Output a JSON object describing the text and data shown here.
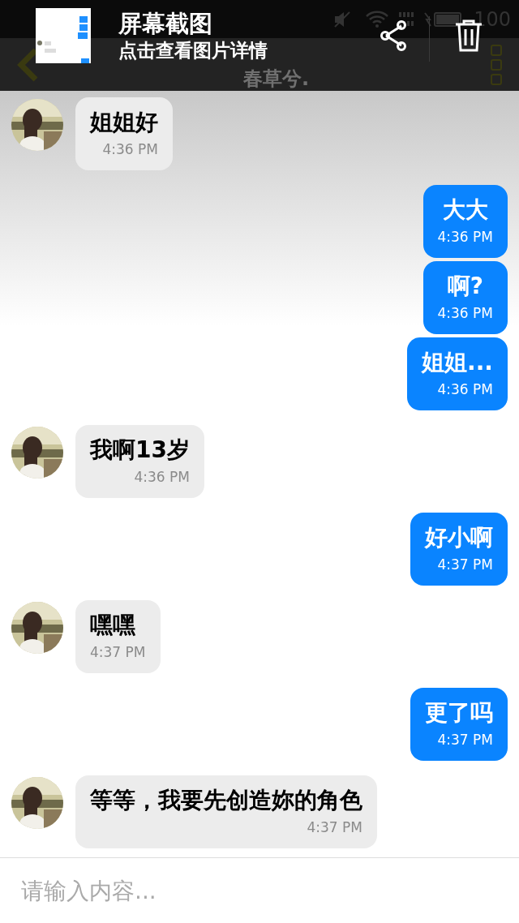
{
  "status_bar": {
    "battery": "100"
  },
  "notification": {
    "title": "屏幕截图",
    "subtitle": "点击查看图片详情"
  },
  "app_bar": {
    "title": "春草兮."
  },
  "messages": [
    {
      "kind": "received",
      "text": "姐姐好",
      "time": "4:36 PM"
    },
    {
      "kind": "sent",
      "text": "大大",
      "time": "4:36 PM"
    },
    {
      "kind": "sent",
      "text": "啊?",
      "time": "4:36 PM"
    },
    {
      "kind": "sent",
      "text": "姐姐...",
      "time": "4:36 PM"
    },
    {
      "kind": "received",
      "text": "我啊13岁",
      "time": "4:36 PM"
    },
    {
      "kind": "sent",
      "text": "好小啊",
      "time": "4:37 PM"
    },
    {
      "kind": "received",
      "text": "嘿嘿",
      "time": "4:37 PM"
    },
    {
      "kind": "sent",
      "text": "更了吗",
      "time": "4:37 PM"
    },
    {
      "kind": "received",
      "text": "等等，我要先创造妳的角色",
      "time": "4:37 PM"
    }
  ],
  "input": {
    "placeholder": "请输入内容..."
  }
}
